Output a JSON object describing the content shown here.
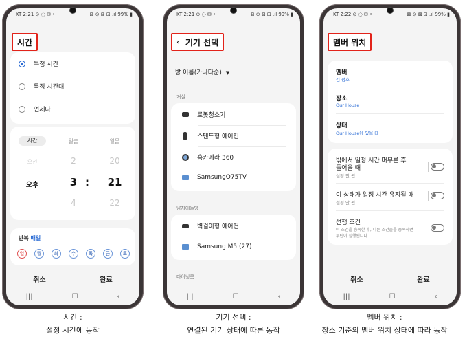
{
  "phone1": {
    "status_left": "KT 2:21 ⊙ ◌ ✉ •",
    "status_right": "⊠ ⊙ ⊠ ⊡ .ıl 99% ▮",
    "title": "시간",
    "options": [
      "특정 시간",
      "특정 시간대",
      "언제나"
    ],
    "picker_tabs": [
      "시간",
      "일출",
      "일몰"
    ],
    "picker_above": [
      "오전",
      "2",
      "20"
    ],
    "picker_main": [
      "오후",
      "3",
      ":",
      "21"
    ],
    "picker_below": [
      "4",
      "22"
    ],
    "repeat_label": "반복",
    "repeat_value": "매일",
    "days": [
      "일",
      "월",
      "화",
      "수",
      "목",
      "금",
      "토"
    ],
    "cancel": "취소",
    "done": "완료"
  },
  "phone2": {
    "status_left": "KT 2:21 ⊙ ◌ ✉ •",
    "status_right": "⊠ ⊙ ⊠ ⊡ .ıl 99% ▮",
    "title": "기기 선택",
    "sort": "방 이름(가나다순)",
    "section1": "거실",
    "devices1": [
      "로봇청소기",
      "스탠드형 에어컨",
      "홈카메라 360",
      "SamsungQ75TV"
    ],
    "section2": "남자애들방",
    "devices2": [
      "벽걸이형 에어컨",
      "Samsung M5 (27)"
    ],
    "section3": "다이닝룸"
  },
  "phone3": {
    "status_left": "KT 2:22 ⊙ ◌ ✉ •",
    "status_right": "⊠ ⊙ ⊠ ⊡ .ıl 99% ▮",
    "title": "멤버 위치",
    "member_label": "멤버",
    "member_value": "김 성호",
    "place_label": "장소",
    "place_value": "Our House",
    "state_label": "상태",
    "state_value": "Our House에 있을 때",
    "opt1_title_1": "밖에서 일정 시간 머무른 후",
    "opt1_title_2": "들어올 때",
    "opt1_sub": "설정 안 됨",
    "opt2_title": "이 상태가 일정 시간 유지될 때",
    "opt2_sub": "설정 안 됨",
    "opt3_title": "선행 조건",
    "opt3_sub_1": "이 조건을 충족한 후, 다른 조건들을 충족하면",
    "opt3_sub_2": "루틴이 실행됩니다."
  },
  "captions": {
    "c1_line1": "시간 :",
    "c1_line2": "설정 시간에 동작",
    "c2_line1": "기기 선택 :",
    "c2_line2": "연결된 기기 상태에 따른 동작",
    "c3_line1": "멤버 위치 :",
    "c3_line2": "장소 기준의 멤버 위치 상태에 따라 동작"
  },
  "navbar": {
    "recent": "|||",
    "home": "☐",
    "back": "‹"
  },
  "colors": {
    "highlight_border": "#e2231a",
    "accent_blue": "#2a6bd4",
    "sunday_red": "#d33"
  }
}
